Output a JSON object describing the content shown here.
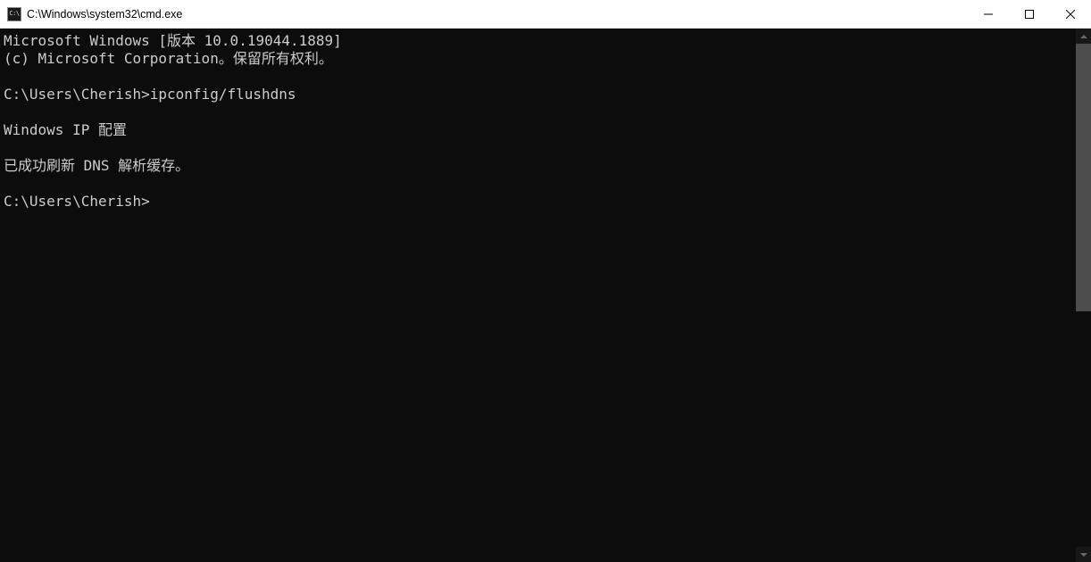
{
  "window": {
    "title": "C:\\Windows\\system32\\cmd.exe"
  },
  "terminal": {
    "lines": {
      "l0": "Microsoft Windows [版本 10.0.19044.1889]",
      "l1": "(c) Microsoft Corporation。保留所有权利。",
      "l2": "",
      "l3": "C:\\Users\\Cherish>ipconfig/flushdns",
      "l4": "",
      "l5": "Windows IP 配置",
      "l6": "",
      "l7": "已成功刷新 DNS 解析缓存。",
      "l8": "",
      "l9": "C:\\Users\\Cherish>"
    }
  }
}
